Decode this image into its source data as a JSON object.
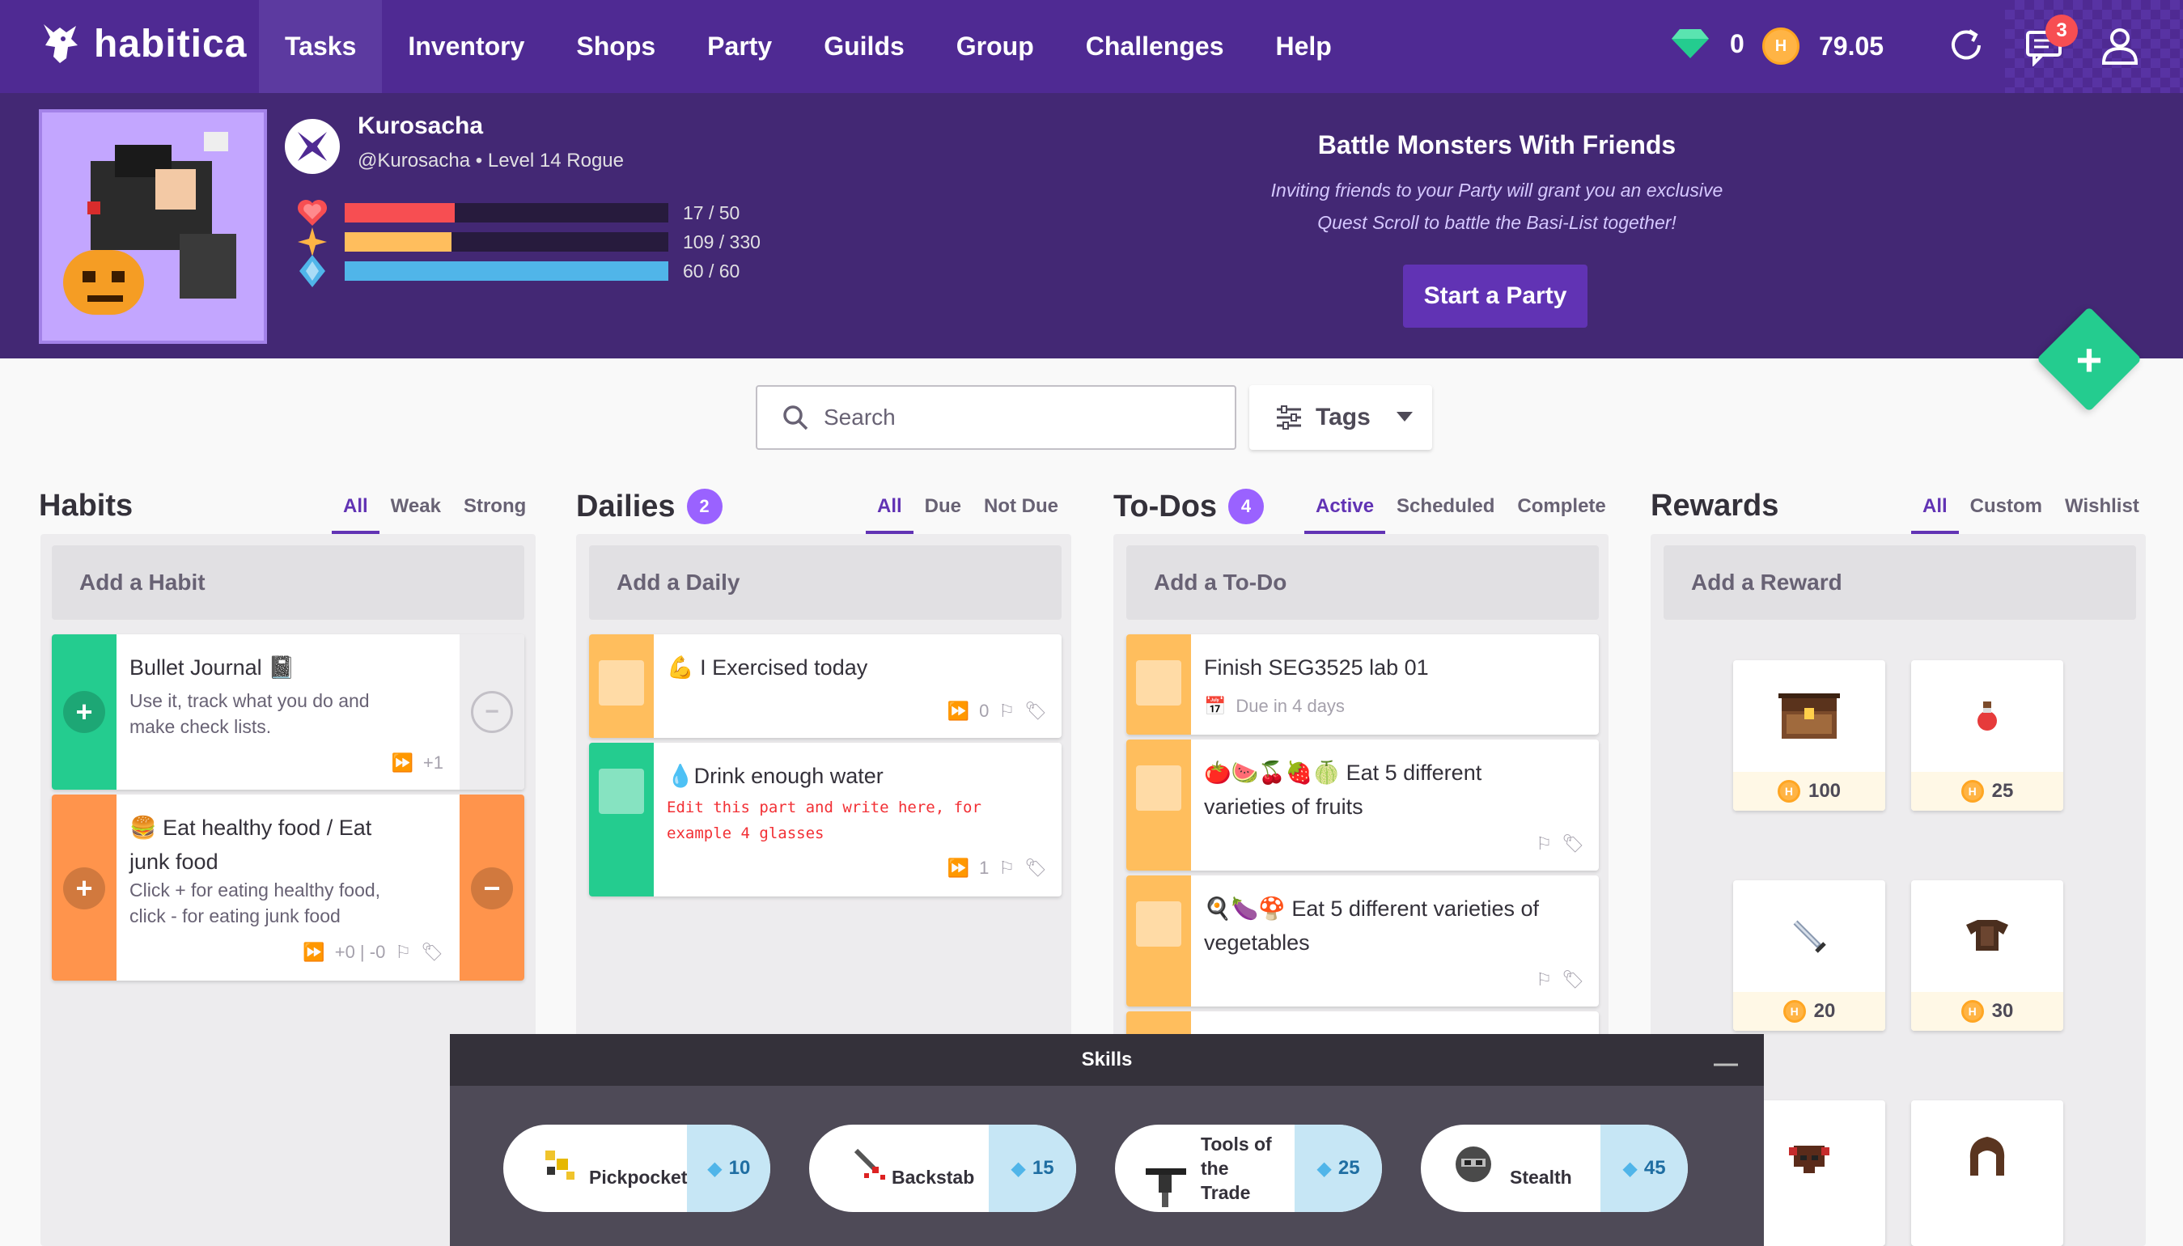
{
  "nav": {
    "brand": "habitica",
    "links": [
      "Tasks",
      "Inventory",
      "Shops",
      "Party",
      "Guilds",
      "Group",
      "Challenges",
      "Help"
    ],
    "gems": "0",
    "gold": "79.05",
    "notifications": "3"
  },
  "user": {
    "name": "Kurosacha",
    "handle": "@Kurosacha",
    "level_class": "Level 14 Rogue",
    "hp": {
      "text": "17 / 50",
      "fraction": 0.34,
      "color": "#f74e52"
    },
    "xp": {
      "text": "109 / 330",
      "fraction": 0.33,
      "color": "#ffbe5d"
    },
    "mp": {
      "text": "60 / 60",
      "fraction": 1.0,
      "color": "#50b5e9"
    }
  },
  "party": {
    "title": "Battle Monsters With Friends",
    "desc_line1": "Inviting friends to your Party will grant you an exclusive",
    "desc_line2": "Quest Scroll to battle the Basi-List together!",
    "button": "Start a Party"
  },
  "search": {
    "placeholder": "Search"
  },
  "tags": {
    "label": "Tags"
  },
  "habits": {
    "title": "Habits",
    "filters": [
      "All",
      "Weak",
      "Strong"
    ],
    "add": "Add a Habit",
    "items": [
      {
        "title": "Bullet Journal 📓",
        "note_line1": "Use it, track what you do and",
        "note_line2": "make check lists.",
        "streak": "+1"
      },
      {
        "title_line1": "🍔 Eat healthy food / Eat",
        "title_line2": "junk food",
        "note_line1": "Click + for eating healthy food,",
        "note_line2": "click - for eating junk food",
        "streak": "+0 | -0"
      }
    ]
  },
  "dailies": {
    "title": "Dailies",
    "count": "2",
    "filters": [
      "All",
      "Due",
      "Not Due"
    ],
    "add": "Add a Daily",
    "items": [
      {
        "title": "💪 I Exercised today",
        "streak": "0"
      },
      {
        "title": "💧Drink enough water",
        "note_line1": "Edit this part and write here, for",
        "note_line2": "example 4 glasses",
        "streak": "1"
      }
    ]
  },
  "todos": {
    "title": "To-Dos",
    "count": "4",
    "filters": [
      "Active",
      "Scheduled",
      "Complete"
    ],
    "add": "Add a To-Do",
    "items": [
      {
        "title": "Finish SEG3525 lab 01",
        "due": "Due in 4 days"
      },
      {
        "title_line1": "🍅🍉🍒🍓🍈 Eat 5 different",
        "title_line2": "varieties of fruits"
      },
      {
        "title_line1": "🍳🍆🍄 Eat 5 different varieties of",
        "title_line2": "vegetables"
      }
    ]
  },
  "rewards": {
    "title": "Rewards",
    "filters": [
      "All",
      "Custom",
      "Wishlist"
    ],
    "add": "Add a Reward",
    "items": [
      {
        "icon": "treasure-chest-icon",
        "price": "100"
      },
      {
        "icon": "health-potion-icon",
        "price": "25"
      },
      {
        "icon": "sword-icon",
        "price": "20"
      },
      {
        "icon": "armor-icon",
        "price": "30"
      },
      {
        "icon": "helmet-icon",
        "price": ""
      },
      {
        "icon": "hood-icon",
        "price": ""
      }
    ]
  },
  "skills": {
    "title": "Skills",
    "items": [
      {
        "name": "Pickpocket",
        "cost": "10"
      },
      {
        "name": "Backstab",
        "cost": "15"
      },
      {
        "name_line1": "Tools of",
        "name_line2": "the",
        "name_line3": "Trade",
        "cost": "25"
      },
      {
        "name": "Stealth",
        "cost": "45"
      }
    ]
  },
  "colors": {
    "nav": "#4f2a93",
    "header": "#432874",
    "habit_good": "#24cc8f",
    "habit_orange": "#ff944c",
    "daily_yellow": "#ffbe5d",
    "daily_green": "#24cc8f",
    "accent": "#6133b4"
  }
}
